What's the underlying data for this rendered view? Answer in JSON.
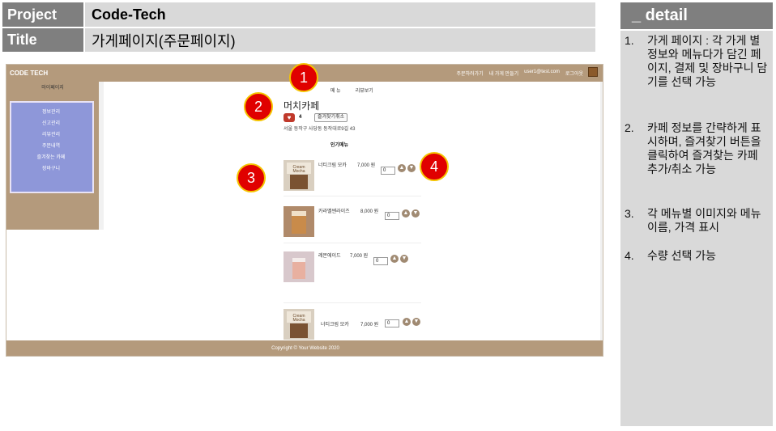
{
  "header": {
    "project_label": "Project",
    "project_value": "Code-Tech",
    "title_label": "Title",
    "title_value": "가게페이지(주문페이지)"
  },
  "detail": {
    "heading": "_ detail",
    "items": [
      {
        "num": "1.",
        "text": "가게 페이지 : 각 가게 별 정보와 메뉴다가 담긴 페이지, 결제 및 장바구니 담기를 선택 가능"
      },
      {
        "num": "2.",
        "text": "카페 정보를 간략하게 표시하며, 즐겨찾기 버튼을 클릭하여 즐겨찾는 카페 추가/취소 가능"
      },
      {
        "num": "3.",
        "text": "각 메뉴별 이미지와 메뉴이름, 가격 표시"
      },
      {
        "num": "4.",
        "text": "수량 선택 가능"
      }
    ]
  },
  "screenshot": {
    "brand": "CODE TECH",
    "nav": [
      "주문하러가기",
      "내 가게 만들기",
      "user1@test.com",
      "로그아웃"
    ],
    "sidebar_title": "마이페이지",
    "sidebar_items": [
      "정보관리",
      "신고관리",
      "리뷰관리",
      "주문내역",
      "즐겨찾는 카페",
      "장바구니"
    ],
    "tabs": [
      "메 뉴",
      "리뷰보기"
    ],
    "cafe_name": "머치카페",
    "like_count": "4",
    "fav_button": "즐겨찾기취소",
    "address": "서울 동작구 사당동 동작대로9길 43",
    "popular_label": "인기메뉴",
    "menu": [
      {
        "name": "너티크림 모카",
        "price": "7,000 원",
        "qty": "0"
      },
      {
        "name": "카라멜쎈라이즈",
        "price": "8,000 원",
        "qty": "0"
      },
      {
        "name": "레몬에이드",
        "price": "7,000 원",
        "qty": "0"
      },
      {
        "name": "너티크림 모카",
        "price": "7,000 원",
        "qty": "0"
      }
    ],
    "footer": "Copyright © Your Website 2020"
  },
  "callouts": [
    "1",
    "2",
    "3",
    "4"
  ],
  "colors": {
    "header_label_bg": "#7f7f7f",
    "header_value_bg": "#d9d9d9",
    "site_brown": "#b49a7c",
    "sidebar_panel": "#8e97d9",
    "callout_red": "#e00000",
    "callout_border": "#f5c400"
  }
}
